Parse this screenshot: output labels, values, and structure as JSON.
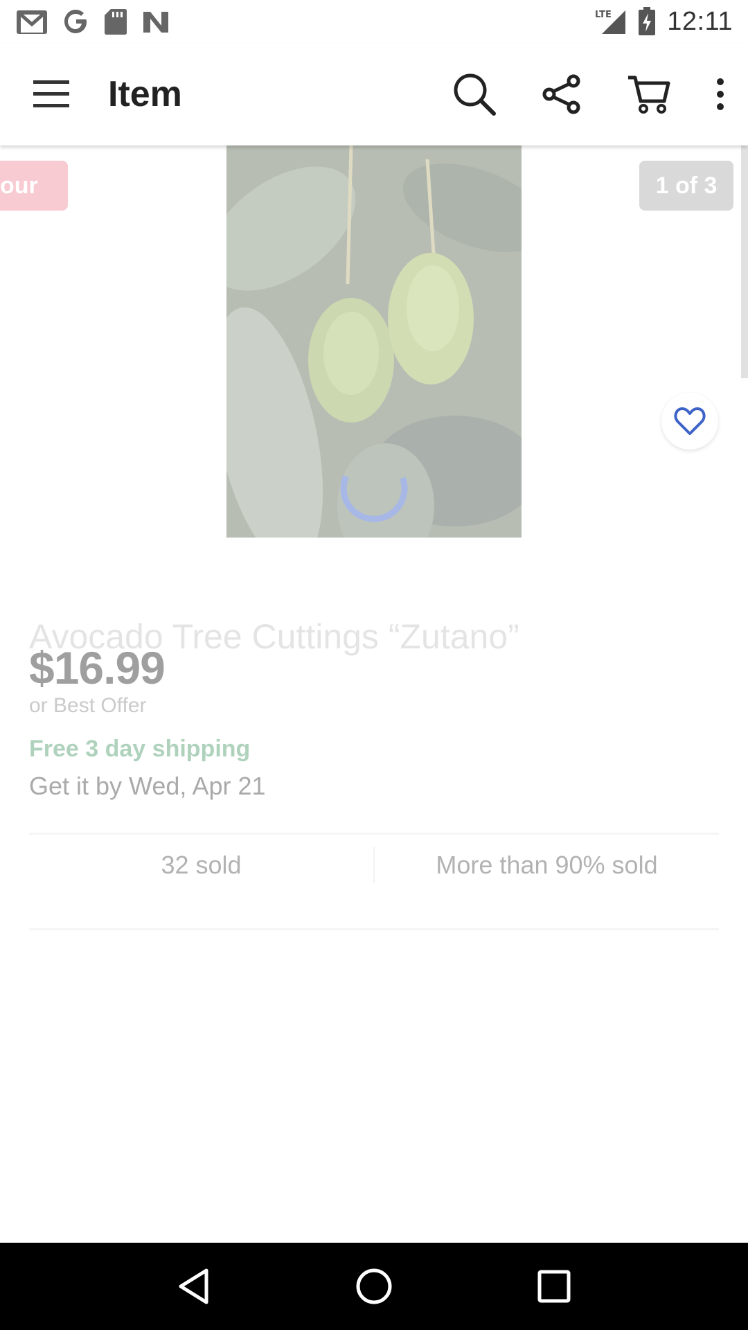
{
  "status_bar": {
    "time": "12:11",
    "network": "LTE",
    "left_icons": [
      "gmail-icon",
      "google-icon",
      "sd-card-icon",
      "n-app-icon"
    ]
  },
  "app_bar": {
    "title": "Item",
    "actions": [
      "search-icon",
      "share-icon",
      "cart-icon",
      "more-vert-icon"
    ]
  },
  "gallery": {
    "discount_badge": "our",
    "counter": "1 of 3",
    "loading": true
  },
  "item": {
    "title": "Avocado Tree Cuttings “Zutano”",
    "price": "$16.99",
    "offer_note": "or Best Offer",
    "shipping": "Free 3 day shipping",
    "delivery": "Get it by Wed, Apr 21",
    "sold": "32 sold",
    "sell_through": "More than 90% sold"
  },
  "colors": {
    "shipping_green": "#4f9c6c",
    "badge_pink": "#f08a9a",
    "counter_gray": "#ababab",
    "spinner_blue": "#3d63c9",
    "watch_heart_blue": "#3d63c9"
  },
  "nav_bar": [
    "back-icon",
    "home-icon",
    "recents-icon"
  ]
}
